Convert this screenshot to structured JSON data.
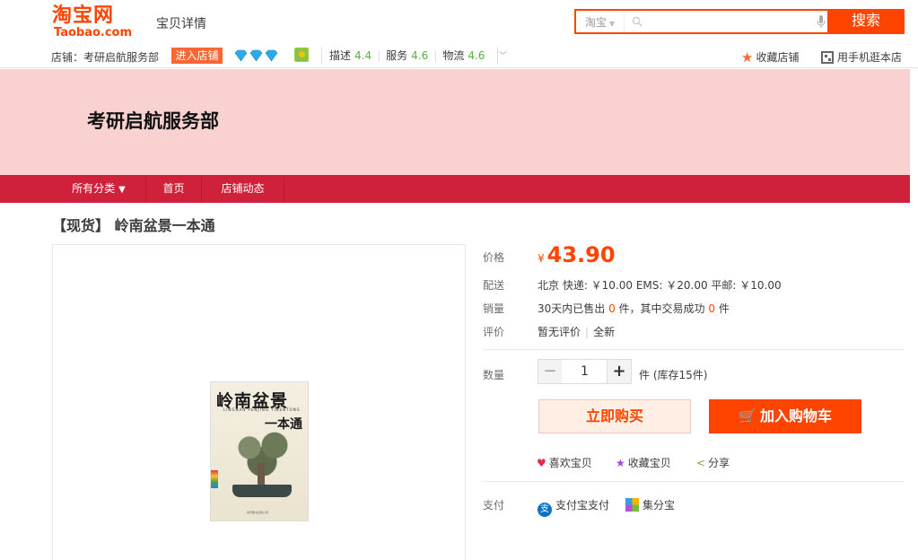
{
  "header": {
    "logo_cn": "淘宝网",
    "logo_en": "Taobao.com",
    "page_title": "宝贝详情",
    "search": {
      "scope": "淘宝",
      "placeholder": "",
      "button": "搜索"
    }
  },
  "shop_bar": {
    "shop_label": "店铺：",
    "shop_name": "考研启航服务部",
    "enter_shop": "进入店铺",
    "scores": [
      {
        "label": "描述",
        "value": "4.4"
      },
      {
        "label": "服务",
        "value": "4.6"
      },
      {
        "label": "物流",
        "value": "4.6"
      }
    ],
    "favorite_shop": "收藏店铺",
    "mobile_shop": "用手机逛本店"
  },
  "banner": {
    "shop_name": "考研启航服务部"
  },
  "nav": {
    "items": [
      "所有分类",
      "首页",
      "店铺动态"
    ]
  },
  "product": {
    "title": "【现货】 岭南盆景一本通",
    "cover": {
      "title": "岭南盆景",
      "subtitle": "LINGNAN PENJING YIBENTONG",
      "title2": "一本通",
      "publisher": "世界图书出版公司"
    },
    "price_label": "价格",
    "currency": "¥",
    "price": "43.90",
    "shipping_label": "配送",
    "shipping": "北京  快递: ￥10.00  EMS: ￥20.00  平邮: ￥10.00",
    "sales_label": "销量",
    "sales_pre": "30天内已售出 ",
    "sales_count": "0",
    "sales_mid": " 件，其中交易成功 ",
    "success_count": "0",
    "sales_post": " 件",
    "review_label": "评价",
    "review_text": "暂无评价",
    "condition": "全新",
    "quantity_label": "数量",
    "quantity": "1",
    "stock_text": "件 (库存15件)",
    "buy_now": "立即购买",
    "add_cart": "加入购物车",
    "like": "喜欢宝贝",
    "collect": "收藏宝贝",
    "share": "分享",
    "payment_label": "支付",
    "pay_alipay": "支付宝支付",
    "pay_points": "集分宝"
  },
  "colors": {
    "accent": "#ff4400",
    "banner": "#f9d1d1",
    "nav": "#d0213b",
    "score_green": "#5ab23c"
  }
}
